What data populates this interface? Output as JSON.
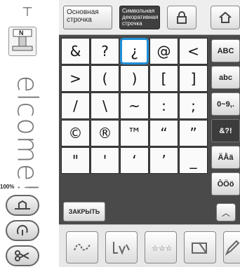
{
  "top_tabs": {
    "basic": "Основная строчка",
    "decorative": "Символьная декоративная строчка"
  },
  "zoom": "100%",
  "close_label": "ЗАКРЫТЬ",
  "grid": [
    [
      "&",
      "?",
      "¿",
      "@",
      "<"
    ],
    [
      ">",
      "(",
      ")",
      "[",
      "]"
    ],
    [
      "/",
      "\\",
      "~",
      ":",
      ";"
    ],
    [
      "©",
      "®",
      "™",
      "“",
      "”"
    ],
    [
      "\"",
      "'",
      "‘",
      "’",
      "_"
    ]
  ],
  "selected_key": "¿",
  "modes": [
    "ABC",
    "abc",
    "0~9,.",
    "&?!",
    "ÄÅä",
    "ÔÖö"
  ],
  "active_mode": "&?!",
  "icons": {
    "tension": "thread-tension-icon",
    "foot": "presser-foot-n-icon",
    "lock": "lock-icon",
    "home": "home-icon",
    "needle": "needle-position-icon",
    "thread": "thread-icon",
    "scissors": "scissors-icon",
    "scroll_up": "chevron-up-icon"
  },
  "preview_text": "elcome!",
  "foot_letter": "N"
}
